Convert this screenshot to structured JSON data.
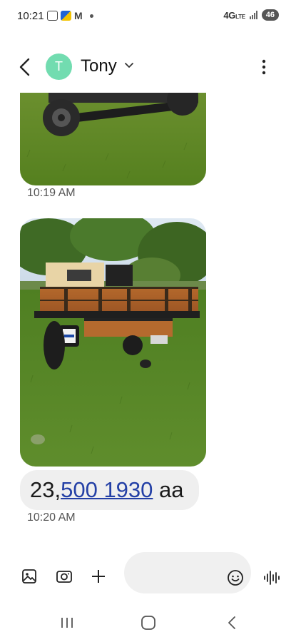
{
  "status_bar": {
    "time": "10:21",
    "network_main": "4G",
    "network_sub": "LTE",
    "battery": "46",
    "icons": [
      "screenshot-icon",
      "news-app-icon",
      "gmail-icon",
      "notification-dot-icon",
      "signal-icon"
    ]
  },
  "header": {
    "contact_name": "Tony",
    "avatar_initial": "T",
    "avatar_color": "#72dcb0",
    "icons": [
      "back-arrow-icon",
      "chevron-down-icon",
      "more-vert-icon"
    ]
  },
  "messages": [
    {
      "type": "image",
      "description_icon": "vehicle-photo",
      "time": "10:19 AM"
    },
    {
      "type": "image",
      "description_icon": "vehicle-photo",
      "time": ""
    },
    {
      "type": "text",
      "text_plain": "23,",
      "text_link": "500 1930",
      "text_suffix": " aa",
      "time": "10:20 AM"
    }
  ],
  "composer": {
    "input_value": "",
    "icons": [
      "gallery-icon",
      "camera-icon",
      "add-icon",
      "emoji-icon",
      "voice-recorder-icon"
    ]
  },
  "navbar": {
    "icons": [
      "recent-apps-icon",
      "home-icon",
      "back-icon"
    ]
  },
  "colors": {
    "link": "#2440a6",
    "bubble_bg": "#efefef",
    "input_bg": "#f0f0f0",
    "timestamp": "#555555"
  }
}
